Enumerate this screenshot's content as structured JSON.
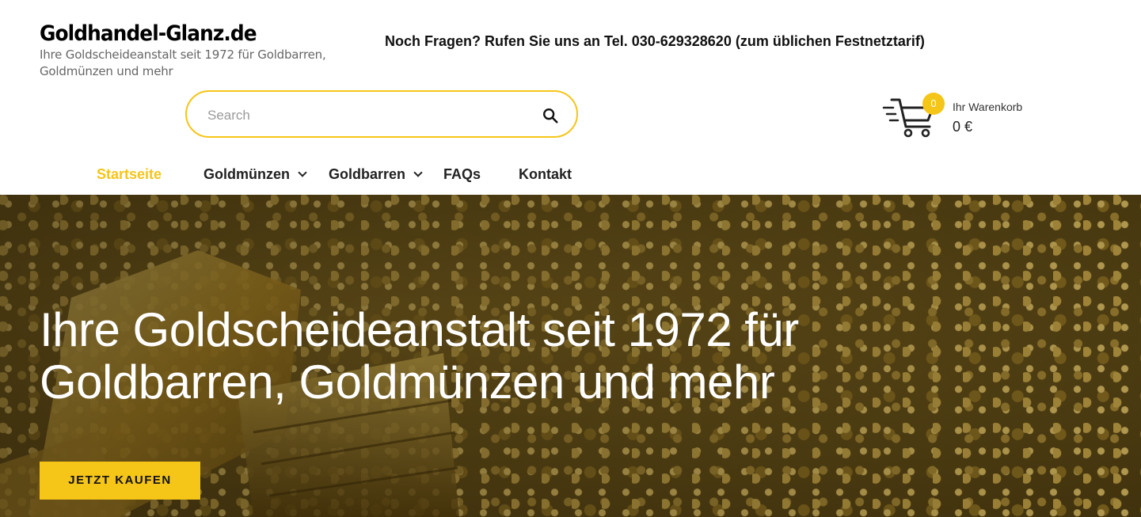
{
  "logo": {
    "title": "Goldhandel-Glanz.de",
    "tagline": "Ihre Goldscheideanstalt seit 1972 für Goldbarren, Goldmünzen und mehr"
  },
  "hotline": "Noch Fragen? Rufen Sie uns an Tel. 030-629328620 (zum üblichen Festnetztarif)",
  "search": {
    "placeholder": "Search",
    "icon": "search-icon"
  },
  "cart": {
    "count": "0",
    "label": "Ihr Warenkorb",
    "total": "0 €",
    "icon": "shopping-cart-icon"
  },
  "nav": {
    "items": [
      {
        "label": "Startseite",
        "active": true
      },
      {
        "label": "Goldmünzen",
        "dropdown": true
      },
      {
        "label": "Goldbarren",
        "dropdown": true
      },
      {
        "label": "FAQs"
      },
      {
        "label": "Kontakt"
      }
    ]
  },
  "hero": {
    "title": "Ihre Goldscheideanstalt seit 1972 für Goldbarren, Goldmünzen und mehr",
    "cta": "JETZT KAUFEN"
  },
  "colors": {
    "accent": "#f5c518",
    "text": "#111111"
  }
}
